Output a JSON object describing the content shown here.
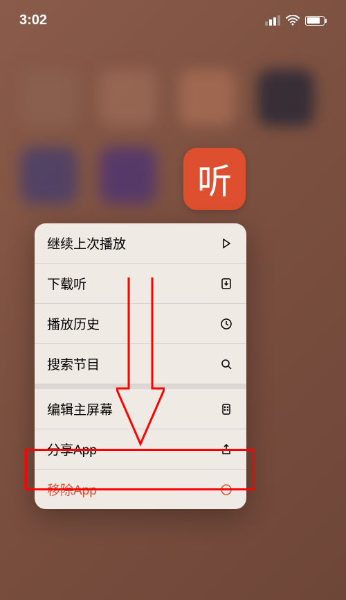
{
  "status_bar": {
    "time": "3:02"
  },
  "app": {
    "icon_glyph": "听"
  },
  "menu": {
    "items": [
      {
        "label": "继续上次播放",
        "icon": "play"
      },
      {
        "label": "下载听",
        "icon": "download"
      },
      {
        "label": "播放历史",
        "icon": "clock"
      },
      {
        "label": "搜索节目",
        "icon": "search"
      },
      {
        "label": "编辑主屏幕",
        "icon": "apps"
      },
      {
        "label": "分享App",
        "icon": "share"
      },
      {
        "label": "移除App",
        "icon": "remove"
      }
    ]
  },
  "annotation": {
    "highlight_target": "移除App",
    "colors": {
      "arrow": "#ff0000",
      "box": "#ff0000"
    }
  }
}
